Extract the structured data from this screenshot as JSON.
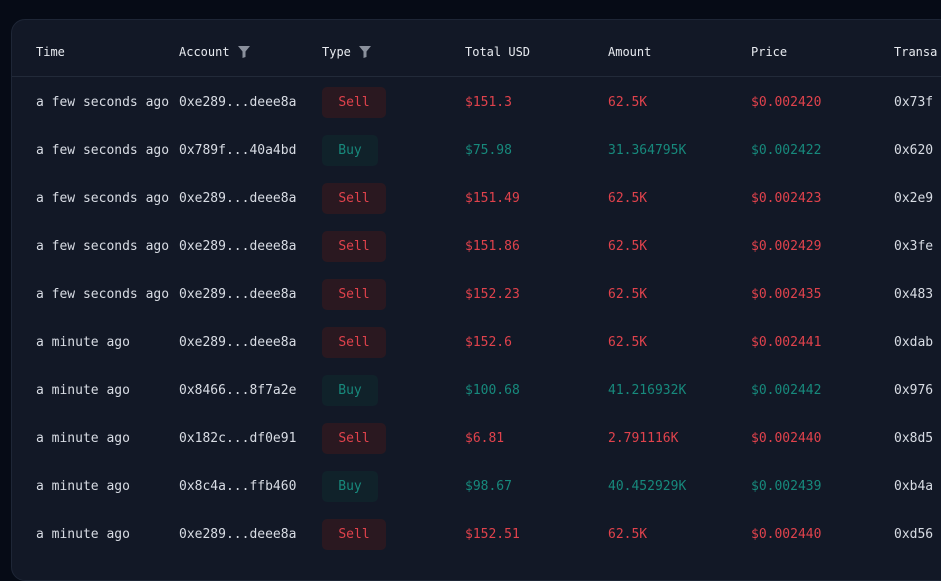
{
  "columns": {
    "time": "Time",
    "account": "Account",
    "type": "Type",
    "total_usd": "Total USD",
    "amount": "Amount",
    "price": "Price",
    "transaction": "Transa"
  },
  "rows": [
    {
      "time": "a few seconds ago",
      "account": "0xe289...deee8a",
      "type": "Sell",
      "total_usd": "$151.3",
      "amount": "62.5K",
      "price": "$0.002420",
      "tx": "0x73f"
    },
    {
      "time": "a few seconds ago",
      "account": "0x789f...40a4bd",
      "type": "Buy",
      "total_usd": "$75.98",
      "amount": "31.364795K",
      "price": "$0.002422",
      "tx": "0x620"
    },
    {
      "time": "a few seconds ago",
      "account": "0xe289...deee8a",
      "type": "Sell",
      "total_usd": "$151.49",
      "amount": "62.5K",
      "price": "$0.002423",
      "tx": "0x2e9"
    },
    {
      "time": "a few seconds ago",
      "account": "0xe289...deee8a",
      "type": "Sell",
      "total_usd": "$151.86",
      "amount": "62.5K",
      "price": "$0.002429",
      "tx": "0x3fe"
    },
    {
      "time": "a few seconds ago",
      "account": "0xe289...deee8a",
      "type": "Sell",
      "total_usd": "$152.23",
      "amount": "62.5K",
      "price": "$0.002435",
      "tx": "0x483"
    },
    {
      "time": "a minute ago",
      "account": "0xe289...deee8a",
      "type": "Sell",
      "total_usd": "$152.6",
      "amount": "62.5K",
      "price": "$0.002441",
      "tx": "0xdab"
    },
    {
      "time": "a minute ago",
      "account": "0x8466...8f7a2e",
      "type": "Buy",
      "total_usd": "$100.68",
      "amount": "41.216932K",
      "price": "$0.002442",
      "tx": "0x976"
    },
    {
      "time": "a minute ago",
      "account": "0x182c...df0e91",
      "type": "Sell",
      "total_usd": "$6.81",
      "amount": "2.791116K",
      "price": "$0.002440",
      "tx": "0x8d5"
    },
    {
      "time": "a minute ago",
      "account": "0x8c4a...ffb460",
      "type": "Buy",
      "total_usd": "$98.67",
      "amount": "40.452929K",
      "price": "$0.002439",
      "tx": "0xb4a"
    },
    {
      "time": "a minute ago",
      "account": "0xe289...deee8a",
      "type": "Sell",
      "total_usd": "$152.51",
      "amount": "62.5K",
      "price": "$0.002440",
      "tx": "0xd56"
    }
  ],
  "colors": {
    "sell": "#e0424c",
    "buy": "#17897c",
    "sell_badge_bg": "#2a1820",
    "buy_badge_bg": "#10222a",
    "panel_bg": "#121826"
  },
  "icons": {
    "filter": "filter-icon"
  }
}
